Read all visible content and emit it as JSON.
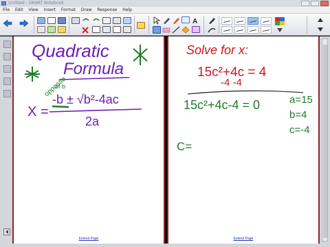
{
  "window": {
    "title": "Untitled - SMART Notebook"
  },
  "menu": [
    "File",
    "Edit",
    "View",
    "Insert",
    "Format",
    "Draw",
    "Response",
    "Help"
  ],
  "left_page": {
    "title_line1": "Quadratic",
    "title_line2": "Formula",
    "note_opposite": "opposite",
    "note_of_b": "of b",
    "x_eq": "X =",
    "numerator": "-b ± √b²-4ac",
    "denominator": "2a",
    "extend_link": "Extend Page"
  },
  "right_page": {
    "heading": "Solve for x:",
    "eq1": "15c²+4c = 4",
    "eq1_sub": "-4   -4",
    "eq2": "15c²+4c-4 = 0",
    "a_val": "a=15",
    "b_val": "b=4",
    "c_val": "c=-4",
    "c_eq": "C=",
    "extend_link": "Extend Page"
  },
  "colors": {
    "purple_ink": "#6a1fb5",
    "green_ink": "#1e7c2a",
    "red_ink": "#d2141c",
    "border_red": "#8e2426",
    "link_blue": "#1a33c4"
  }
}
